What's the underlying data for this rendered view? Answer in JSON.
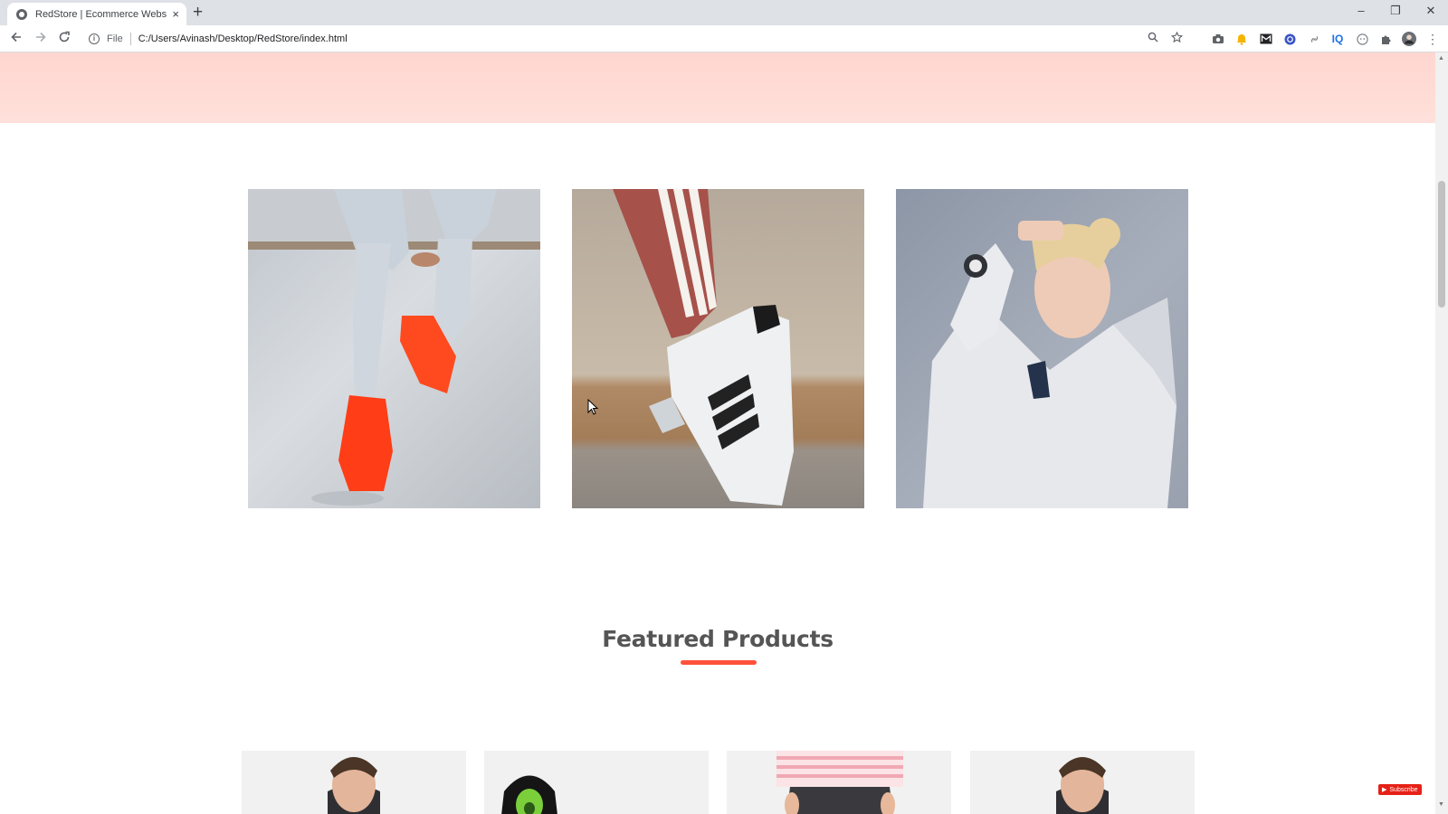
{
  "browser": {
    "tab_title": "RedStore | Ecommerce Website D",
    "tab_close": "×",
    "new_tab": "+",
    "scheme_label": "File",
    "url": "C:/Users/Avinash/Desktop/RedStore/index.html",
    "minimize": "–",
    "restore": "❐",
    "close": "✕",
    "extension_icons": [
      "camera-icon",
      "bell-icon",
      "mail-icon",
      "globe-extension-icon",
      "link-icon",
      "iq-icon",
      "ghost-icon",
      "puzzle-icon",
      "profile-avatar"
    ]
  },
  "page": {
    "hero_band_color": "#ffd6d0",
    "categories": [
      {
        "name": "red sneakers on concrete ledge"
      },
      {
        "name": "white striped sneaker with track pants"
      },
      {
        "name": "woman in grey hoodie with watch"
      }
    ],
    "featured": {
      "title": "Featured Products",
      "accent_color": "#ff523b"
    },
    "products": [
      {
        "name": "man portrait"
      },
      {
        "name": "black hoodie product"
      },
      {
        "name": "striped top product"
      },
      {
        "name": "man portrait"
      }
    ],
    "subscribe_label": "Subscribe"
  }
}
